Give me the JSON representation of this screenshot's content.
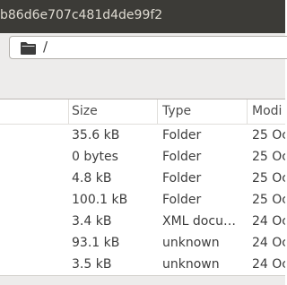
{
  "window": {
    "title": "b86d6e707c481d4de99f2"
  },
  "location": {
    "icon": "folder-icon",
    "path": "/"
  },
  "columns": {
    "size": "Size",
    "type": "Type",
    "modified": "Modi"
  },
  "rows": [
    {
      "size": "35.6 kB",
      "type": "Folder",
      "modified": "25 Oc"
    },
    {
      "size": "0 bytes",
      "type": "Folder",
      "modified": "25 Oc"
    },
    {
      "size": "4.8 kB",
      "type": "Folder",
      "modified": "25 Oc"
    },
    {
      "size": "100.1 kB",
      "type": "Folder",
      "modified": "25 Oc"
    },
    {
      "size": "3.4 kB",
      "type": "XML docu…",
      "modified": "24 Oc"
    },
    {
      "size": "93.1 kB",
      "type": "unknown",
      "modified": "24 Oc"
    },
    {
      "size": "3.5 kB",
      "type": "unknown",
      "modified": "24 Oc"
    }
  ]
}
